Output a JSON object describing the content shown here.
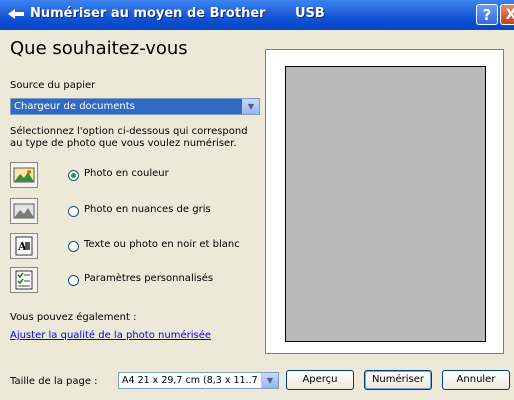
{
  "window": {
    "title": "Numériser au moyen de Brother",
    "connection": "USB",
    "help_label": "?",
    "close_label": "X"
  },
  "heading": "Que souhaitez-vous",
  "paper_source": {
    "label": "Source du papier",
    "selected": "Chargeur de documents"
  },
  "description": "Sélectionnez l'option ci-dessous qui correspond au type de photo que vous voulez numériser.",
  "options": [
    {
      "label": "Photo en couleur",
      "selected": true,
      "icon": "color-photo-icon"
    },
    {
      "label": "Photo en nuances de gris",
      "selected": false,
      "icon": "grayscale-photo-icon"
    },
    {
      "label": "Texte ou photo en noir et blanc",
      "selected": false,
      "icon": "bw-text-photo-icon"
    },
    {
      "label": "Paramètres personnalisés",
      "selected": false,
      "icon": "custom-settings-icon"
    }
  ],
  "also_text": "Vous pouvez également :",
  "adjust_link": "Ajuster la qualité de la photo numérisée",
  "page_size": {
    "label": "Taille de la page :",
    "selected": "A4 21 x 29,7 cm (8,3 x 11..7 po)"
  },
  "buttons": {
    "preview": "Aperçu",
    "scan": "Numériser",
    "cancel": "Annuler"
  },
  "colors": {
    "titlebar": "#0a4fd3",
    "selection": "#316ac5",
    "link": "#0000ee",
    "preview_page": "#b9b9b9"
  }
}
